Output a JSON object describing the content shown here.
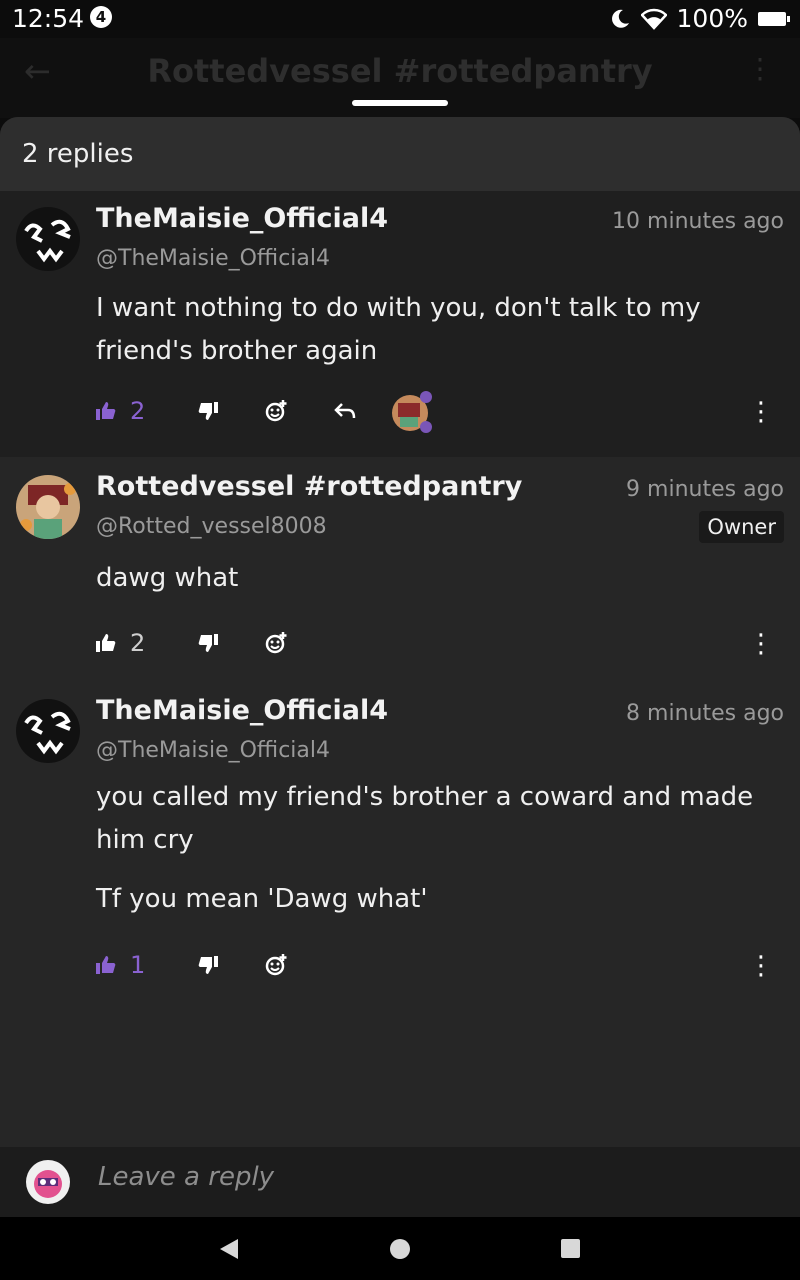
{
  "status_bar": {
    "time": "12:54",
    "notification_count": "4",
    "battery": "100%"
  },
  "background_header": {
    "title": "Rottedvessel #rottedpantry"
  },
  "sheet": {
    "reply_count": "2 replies"
  },
  "comments": [
    {
      "author": "TheMaisie_Official4",
      "handle": "@TheMaisie_Official4",
      "time": "10 minutes ago",
      "body": [
        "I want nothing to do with you, don't talk to my friend's brother again"
      ],
      "likes": "2",
      "liked": true
    },
    {
      "author": "Rottedvessel #rottedpantry",
      "handle": "@Rotted_vessel8008",
      "time": "9 minutes ago",
      "badge": "Owner",
      "body": [
        "dawg what"
      ],
      "likes": "2",
      "liked": false
    },
    {
      "author": "TheMaisie_Official4",
      "handle": "@TheMaisie_Official4",
      "time": "8 minutes ago",
      "body": [
        "you called my friend's brother a coward and made him cry",
        "Tf you mean 'Dawg what'"
      ],
      "likes": "1",
      "liked": true
    }
  ],
  "reply_bar": {
    "placeholder": "Leave a reply"
  },
  "colors": {
    "accent": "#8a62d1",
    "sheet_bg": "#262626"
  }
}
